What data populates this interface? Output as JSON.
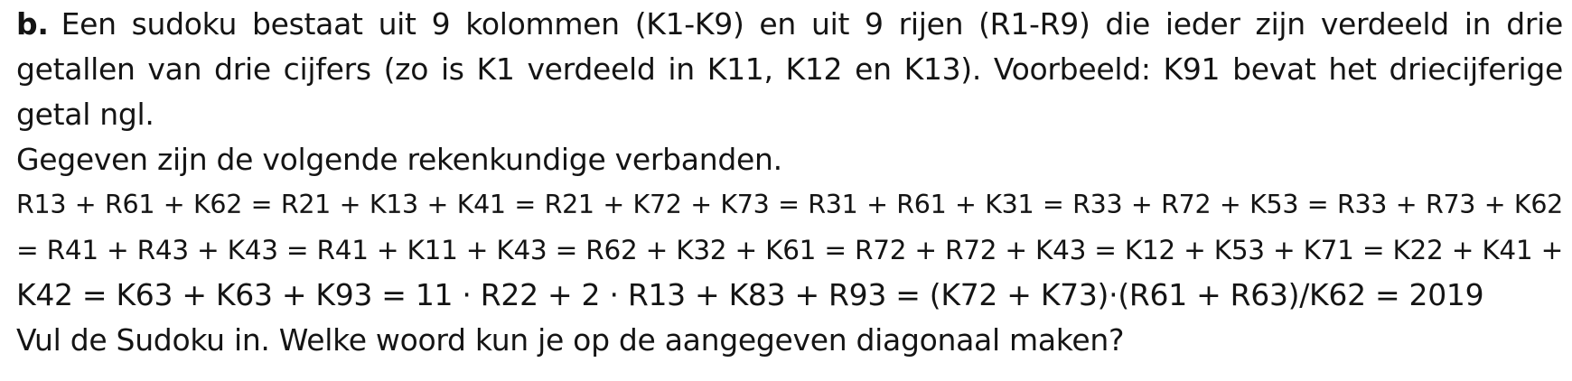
{
  "paragraph": {
    "marker": "b.",
    "lines": [
      "Een sudoku bestaat uit 9 kolommen (K1-K9) en uit 9 rijen (R1-R9) die ieder zijn verdeeld in drie",
      "getallen van drie cijfers (zo is K1 verdeeld in K11, K12 en K13). Voorbeeld: K91 bevat het driecijferige",
      "getal ngl.",
      "Gegeven zijn de volgende rekenkundige verbanden.",
      "R13 + R61 + K62 = R21 + K13 + K41 = R21 + K72 + K73 = R31 + R61 + K31 = R33 + R72 + K53 = R33 + R73 + K62",
      "= R41 + R43 + K43 = R41 + K11 + K43 = R62 + K32 + K61 = R72 + R72 + K43 = K12 + K53 + K71 = K22 + K41 +",
      "K42 = K63 + K63 + K93 = 11 · R22 + 2 · R13 + K83 + R93 = (K72 + K73)·(R61 + R63)/K62 = 2019",
      "Vul de Sudoku in. Welke woord kun je op de aangegeven diagonaal maken?"
    ]
  }
}
